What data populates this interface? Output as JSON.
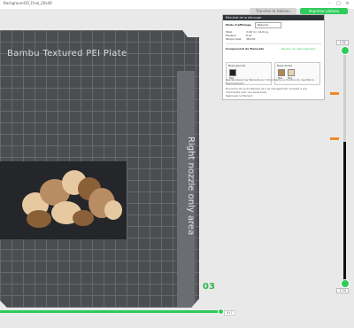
{
  "window": {
    "title": "Background10_Final_20x40"
  },
  "toolbar": {
    "slice_label": "Trancher le tableau",
    "print_label": "Imprimer plateau"
  },
  "bed": {
    "plate_label": "Bambu Textured PEI Plate",
    "nozzle_label": "Right nozzle only area",
    "plate_number": "03"
  },
  "slider": {
    "bottom_value": "917",
    "top_value": "1.32",
    "bottom_layer": "1.74"
  },
  "panel": {
    "header": "Résultat de la découpe",
    "mode_label": "Mode d'affichage",
    "mode_value": "Résumé",
    "total_label": "Total",
    "total_value": "3,99 m | 12,01 g",
    "height_label": "Hauteur",
    "height_value": "6,47",
    "time_label": "Temps total",
    "time_value": "38m32",
    "grouping_label": "Groupement de filaments",
    "grouping_link": "Revenir au regroupement",
    "left_nozzle": {
      "title": "Buse gauche",
      "filaments": [
        "PLA"
      ]
    },
    "right_nozzle": {
      "title": "Buse droite",
      "filaments": [
        "PLA",
        "PLA"
      ]
    },
    "note1": "Veuillez placer les filaments sur l'imprimante en fonction du résultat du regroupement.",
    "note2": "Économie de 1g de filament et 1 de changements comparé à une imprimante avec une seule buse.",
    "details_link": "Regrouper le filament"
  },
  "colors": {
    "accent": "#2ecc5a",
    "bed": "#4b4d50"
  }
}
